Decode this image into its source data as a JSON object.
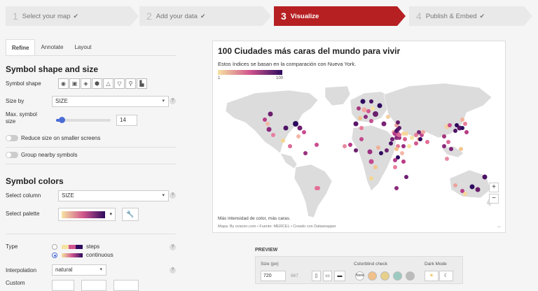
{
  "steps": [
    {
      "num": "1",
      "label": "Select your map",
      "done": "✔"
    },
    {
      "num": "2",
      "label": "Add your data",
      "done": "✔"
    },
    {
      "num": "3",
      "label": "Visualize",
      "done": ""
    },
    {
      "num": "4",
      "label": "Publish & Embed",
      "done": "✔"
    }
  ],
  "tabs": [
    "Refine",
    "Annotate",
    "Layout"
  ],
  "symbol_shape_section": {
    "title": "Symbol shape and size",
    "shape_label": "Symbol shape",
    "shapes": [
      "circle-icon",
      "square-icon",
      "diamond-icon",
      "hexagon-icon",
      "triangle-up-icon",
      "triangle-down-icon",
      "marker-icon",
      "chart-icon"
    ],
    "size_by_label": "Size by",
    "size_by_value": "SIZE",
    "max_size_label": "Max. symbol size",
    "max_size_value": "14",
    "max_size_fraction": 0.1,
    "reduce_label": "Reduce size on smaller screens",
    "group_label": "Group nearby symbols"
  },
  "symbol_colors_section": {
    "title": "Symbol colors",
    "column_label": "Select column",
    "column_value": "SIZE",
    "palette_label": "Select palette",
    "type_label": "Type",
    "type_options": [
      "steps",
      "continuous"
    ],
    "type_selected": "continuous",
    "interpolation_label": "Interpolation",
    "interpolation_value": "natural",
    "custom_label": "Custom"
  },
  "chart": {
    "title": "100 Ciudades más caras del mundo para vivir",
    "subtitle": "Estos índices se basan en la comparación con Nueva York.",
    "legend_min": "1",
    "legend_max": "100",
    "notes": "Más intensidad de color, más caras.",
    "source": "Mapa: By ovacen.com • Fuente: MERCEL • Creado con Datawrapper",
    "zoom_in": "+",
    "zoom_out": "−"
  },
  "colors": {
    "accent": "#b62023",
    "palette_low": "#f7e3a1",
    "palette_mid": "#d0558d",
    "palette_high": "#2e0a5e"
  },
  "preview": {
    "title": "PREVIEW",
    "size_label": "Size (px)",
    "width": "720",
    "height": "867",
    "colorblind_label": "Colorblind check",
    "darkmode_label": "Dark Mode",
    "colorblind_none": "None"
  }
}
